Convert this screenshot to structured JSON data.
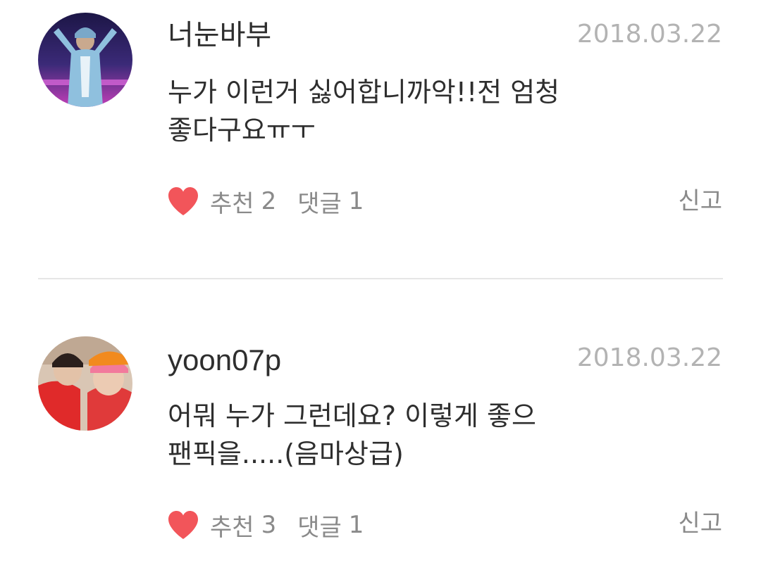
{
  "comments": [
    {
      "username": "너눈바부",
      "date": "2018.03.22",
      "line1": "누가 이런거 싫어합니까악!!전 엄청",
      "line2": "좋다구요ㅠㅜ",
      "like_label": "추천",
      "like_count": "2",
      "reply_label": "댓글",
      "reply_count": "1",
      "report_label": "신고"
    },
    {
      "username": "yoon07p",
      "date": "2018.03.22",
      "line1": "어뭐 누가 그런데요? 이렇게 좋으",
      "line2": "팬픽을.....(음마상급)",
      "like_label": "추천",
      "like_count": "3",
      "reply_label": "댓글",
      "reply_count": "1",
      "report_label": "신고"
    }
  ],
  "colors": {
    "heart": "#f2555a",
    "text": "#2e2e2e",
    "muted": "#8a8a8a",
    "date": "#b3b3b3",
    "divider": "#e6e6e6"
  }
}
